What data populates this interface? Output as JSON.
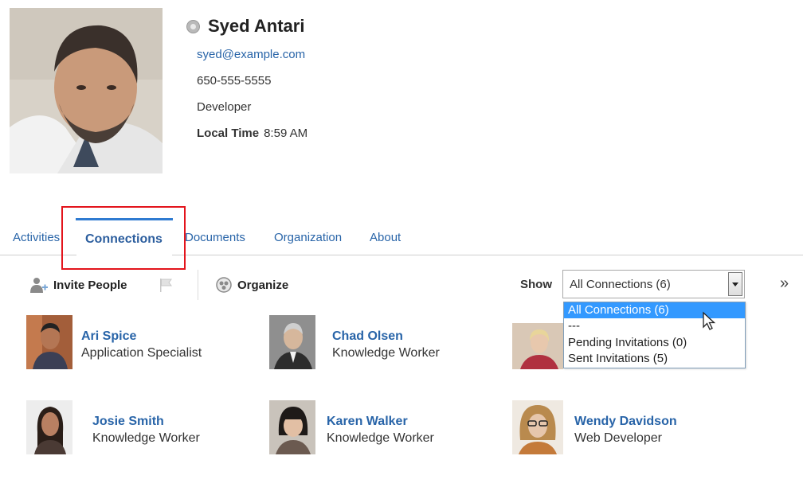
{
  "profile": {
    "name": "Syed Antari",
    "email": "syed@example.com",
    "phone": "650-555-5555",
    "title": "Developer",
    "local_time_label": "Local Time",
    "local_time": "8:59 AM"
  },
  "tabs": {
    "activities": "Activities",
    "connections": "Connections",
    "documents": "Documents",
    "organization": "Organization",
    "about": "About"
  },
  "toolbar": {
    "invite_label": "Invite People",
    "organize_label": "Organize",
    "show_label": "Show",
    "show_value": "All Connections (6)",
    "more_glyph": "»"
  },
  "dropdown": {
    "options": [
      "All Connections (6)",
      "---",
      "Pending Invitations (0)",
      "Sent Invitations (5)"
    ],
    "selected": "All Connections (6)"
  },
  "people": [
    {
      "name": "Ari Spice",
      "role": "Application Specialist"
    },
    {
      "name": "Chad Olsen",
      "role": "Knowledge Worker"
    },
    {
      "name": "",
      "role": ""
    },
    {
      "name": "Josie Smith",
      "role": "Knowledge Worker"
    },
    {
      "name": "Karen Walker",
      "role": "Knowledge Worker"
    },
    {
      "name": "Wendy Davidson",
      "role": "Web Developer"
    }
  ],
  "colors": {
    "link": "#2864a8",
    "active_tab_bar": "#2f7bd1",
    "highlight_box": "#e3141c",
    "dropdown_selected": "#3399ff"
  }
}
